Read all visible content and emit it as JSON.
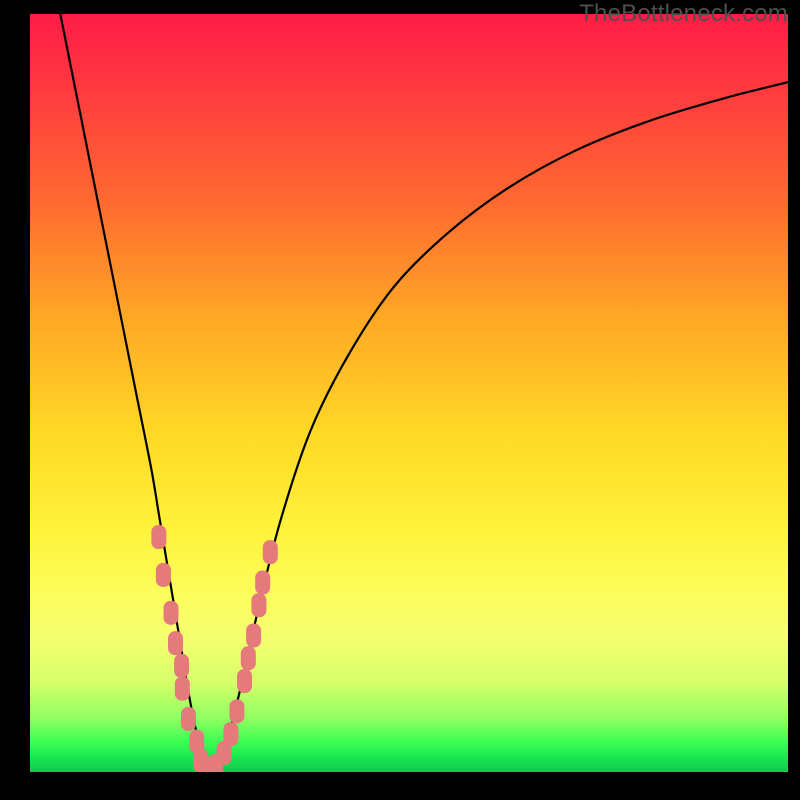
{
  "watermark": "TheBottleneck.com",
  "chart_data": {
    "type": "line",
    "title": "",
    "xlabel": "",
    "ylabel": "",
    "xlim": [
      0,
      100
    ],
    "ylim": [
      0,
      100
    ],
    "grid": false,
    "legend": false,
    "series": [
      {
        "name": "bottleneck-curve",
        "x": [
          4,
          6,
          8,
          10,
          12,
          14,
          16,
          17,
          18,
          19,
          20,
          21,
          22,
          23,
          24,
          25,
          26,
          28,
          30,
          33,
          37,
          42,
          48,
          55,
          63,
          72,
          82,
          92,
          100
        ],
        "y": [
          100,
          90,
          80,
          70,
          60,
          50,
          40,
          34,
          28,
          22,
          16,
          10,
          5,
          1,
          0,
          1,
          4,
          12,
          21,
          33,
          45,
          55,
          64,
          71,
          77,
          82,
          86,
          89,
          91
        ]
      }
    ],
    "markers": {
      "name": "data-points",
      "color": "#e47a7b",
      "shape": "rounded-rect",
      "points": [
        {
          "x": 17.0,
          "y": 31
        },
        {
          "x": 17.6,
          "y": 26
        },
        {
          "x": 18.6,
          "y": 21
        },
        {
          "x": 19.2,
          "y": 17
        },
        {
          "x": 20.0,
          "y": 14
        },
        {
          "x": 20.1,
          "y": 11
        },
        {
          "x": 20.9,
          "y": 7
        },
        {
          "x": 22.0,
          "y": 4
        },
        {
          "x": 22.5,
          "y": 1.5
        },
        {
          "x": 23.5,
          "y": 0.5
        },
        {
          "x": 24.5,
          "y": 0.8
        },
        {
          "x": 25.6,
          "y": 2.5
        },
        {
          "x": 26.5,
          "y": 5
        },
        {
          "x": 27.3,
          "y": 8
        },
        {
          "x": 28.3,
          "y": 12
        },
        {
          "x": 28.8,
          "y": 15
        },
        {
          "x": 29.5,
          "y": 18
        },
        {
          "x": 30.2,
          "y": 22
        },
        {
          "x": 30.7,
          "y": 25
        },
        {
          "x": 31.7,
          "y": 29
        }
      ]
    }
  }
}
